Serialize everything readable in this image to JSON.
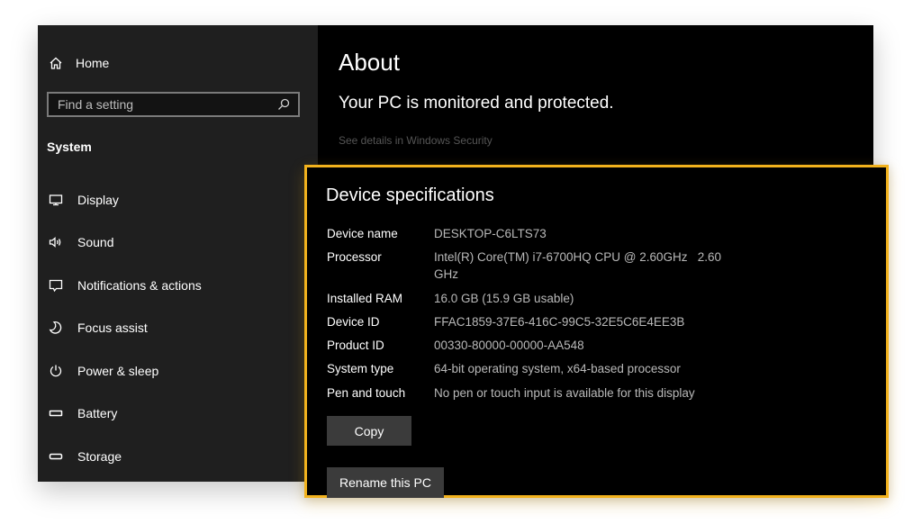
{
  "sidebar": {
    "home_label": "Home",
    "home_icon": "home-icon",
    "search": {
      "placeholder": "Find a setting",
      "value": "",
      "icon": "search-icon"
    },
    "section_title": "System",
    "items": [
      {
        "label": "Display",
        "icon": "monitor-icon"
      },
      {
        "label": "Sound",
        "icon": "speaker-icon"
      },
      {
        "label": "Notifications & actions",
        "icon": "notification-icon"
      },
      {
        "label": "Focus assist",
        "icon": "moon-icon"
      },
      {
        "label": "Power & sleep",
        "icon": "power-icon"
      },
      {
        "label": "Battery",
        "icon": "battery-icon"
      },
      {
        "label": "Storage",
        "icon": "storage-icon"
      }
    ]
  },
  "main": {
    "title": "About",
    "protection_status": "Your PC is monitored and protected.",
    "security_link": "See details in Windows Security"
  },
  "device_specs": {
    "title": "Device specifications",
    "rows": [
      {
        "label": "Device name",
        "value": "DESKTOP-C6LTS73"
      },
      {
        "label": "Processor",
        "value": "Intel(R) Core(TM) i7-6700HQ CPU @ 2.60GHz   2.60 GHz"
      },
      {
        "label": "Installed RAM",
        "value": "16.0 GB (15.9 GB usable)"
      },
      {
        "label": "Device ID",
        "value": "FFAC1859-37E6-416C-99C5-32E5C6E4EE3B"
      },
      {
        "label": "Product ID",
        "value": "00330-80000-00000-AA548"
      },
      {
        "label": "System type",
        "value": "64-bit operating system, x64-based processor"
      },
      {
        "label": "Pen and touch",
        "value": "No pen or touch input is available for this display"
      }
    ],
    "copy_label": "Copy",
    "rename_label": "Rename this PC"
  },
  "colors": {
    "highlight": "#f2b21d",
    "sidebar_bg": "#1f1f1f",
    "main_bg": "#000000",
    "button_bg": "#3b3b3b"
  }
}
